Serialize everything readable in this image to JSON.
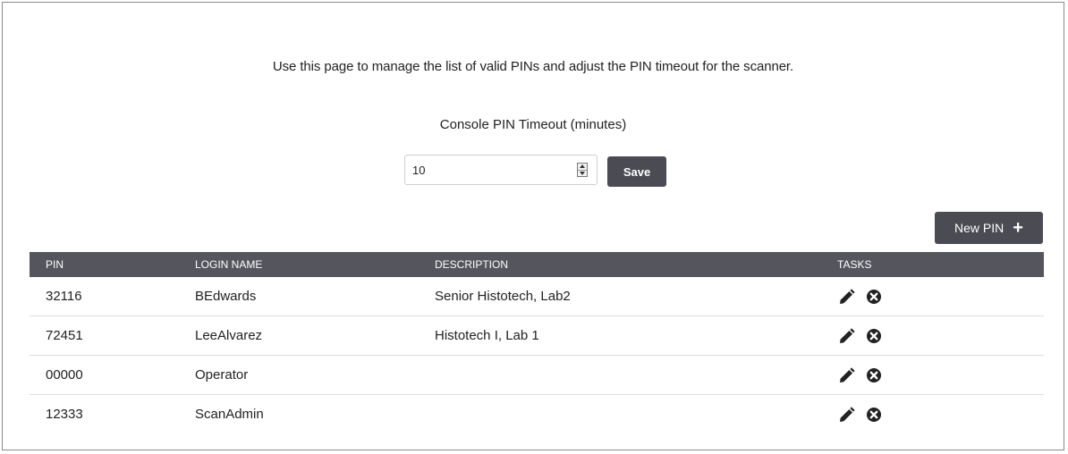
{
  "intro_text": "Use this page to manage the list of valid PINs and adjust the PIN timeout for the scanner.",
  "timeout": {
    "label": "Console PIN Timeout (minutes)",
    "value": "10",
    "save_label": "Save"
  },
  "new_pin": {
    "label": "New PIN",
    "icon": "plus-icon"
  },
  "table": {
    "columns": [
      "PIN",
      "LOGIN NAME",
      "DESCRIPTION",
      "TASKS"
    ],
    "rows": [
      {
        "pin": "32116",
        "login": "BEdwards",
        "description": "Senior Histotech, Lab2"
      },
      {
        "pin": "72451",
        "login": "LeeAlvarez",
        "description": "Histotech I, Lab 1"
      },
      {
        "pin": "00000",
        "login": "Operator",
        "description": ""
      },
      {
        "pin": "12333",
        "login": "ScanAdmin",
        "description": ""
      }
    ],
    "task_icons": [
      "pencil-icon",
      "delete-circle-icon"
    ]
  },
  "colors": {
    "header_bg": "#54555d",
    "button_bg": "#4a4b53"
  }
}
